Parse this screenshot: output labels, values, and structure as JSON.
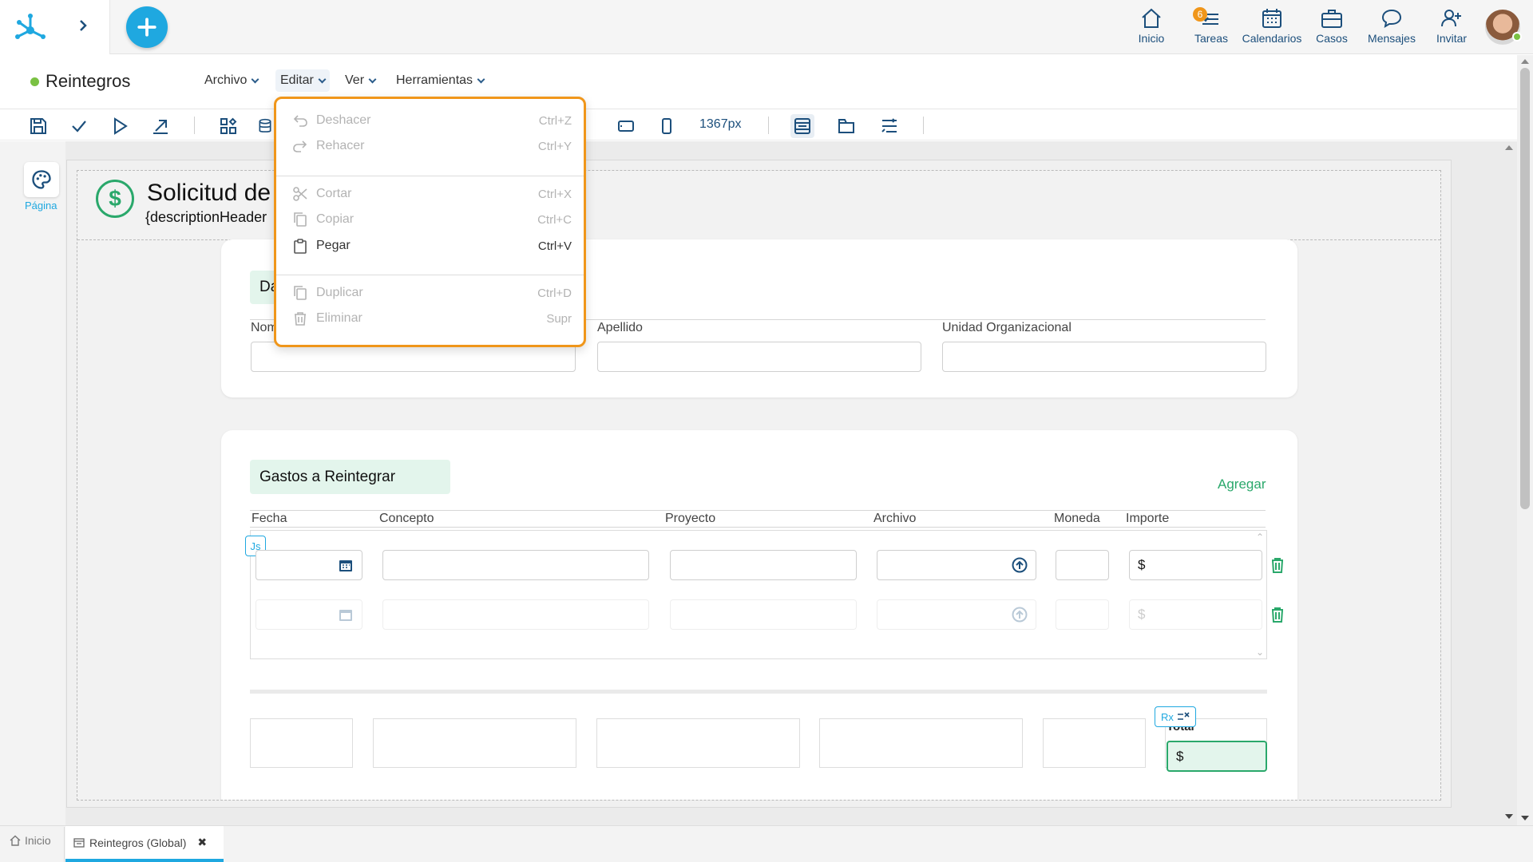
{
  "topnav": {
    "items": [
      {
        "label": "Inicio",
        "icon": "home-icon"
      },
      {
        "label": "Tareas",
        "icon": "tasks-icon",
        "badge": "6"
      },
      {
        "label": "Calendarios",
        "icon": "calendar-icon"
      },
      {
        "label": "Casos",
        "icon": "briefcase-icon"
      },
      {
        "label": "Mensajes",
        "icon": "chat-icon"
      },
      {
        "label": "Invitar",
        "icon": "invite-icon"
      }
    ]
  },
  "header": {
    "title": "Reintegros",
    "status_color": "#7ac143",
    "menus": [
      "Archivo",
      "Editar",
      "Ver",
      "Herramientas"
    ]
  },
  "toolbar": {
    "width_value": "1367px"
  },
  "left_panel": {
    "page_label": "Página"
  },
  "form": {
    "title": "Solicitud de",
    "subtitle": "{descriptionHeader",
    "section1": {
      "title": "Da",
      "fields": [
        "Nom",
        "Apellido",
        "Unidad Organizacional"
      ]
    },
    "section2": {
      "title": "Gastos a Reintegrar",
      "add_label": "Agregar",
      "columns": [
        "Fecha",
        "Concepto",
        "Proyecto",
        "Archivo",
        "Moneda",
        "Importe"
      ],
      "currency_symbol": "$",
      "js_badge": "Js",
      "rx_badge": "Rx",
      "total_label": "Total",
      "total_value": "$"
    }
  },
  "dropdown": {
    "items": [
      {
        "label": "Deshacer",
        "shortcut": "Ctrl+Z",
        "enabled": false,
        "icon": "undo-icon"
      },
      {
        "label": "Rehacer",
        "shortcut": "Ctrl+Y",
        "enabled": false,
        "icon": "redo-icon"
      },
      {
        "label": "Cortar",
        "shortcut": "Ctrl+X",
        "enabled": false,
        "icon": "scissors-icon"
      },
      {
        "label": "Copiar",
        "shortcut": "Ctrl+C",
        "enabled": false,
        "icon": "copy-icon"
      },
      {
        "label": "Pegar",
        "shortcut": "Ctrl+V",
        "enabled": true,
        "icon": "paste-icon"
      },
      {
        "label": "Duplicar",
        "shortcut": "Ctrl+D",
        "enabled": false,
        "icon": "duplicate-icon"
      },
      {
        "label": "Eliminar",
        "shortcut": "Supr",
        "enabled": false,
        "icon": "trash-icon"
      }
    ]
  },
  "bottom_tabs": [
    {
      "label": "Inicio"
    },
    {
      "label": "Reintegros (Global)",
      "close": "✖"
    }
  ],
  "colors": {
    "accent_blue": "#1fa8e0",
    "green": "#2aa86b",
    "dropdown_border": "#f0961a"
  }
}
